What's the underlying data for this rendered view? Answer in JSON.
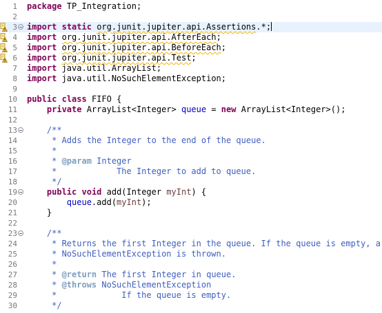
{
  "editor": {
    "lines": [
      {
        "n": "1",
        "tokens": [
          [
            "kw",
            "package"
          ],
          [
            "",
            " TP_Integration;"
          ]
        ]
      },
      {
        "n": "2",
        "tokens": []
      },
      {
        "n": "3",
        "fold": true,
        "marker": "warning",
        "current": true,
        "caret": true,
        "tokens": [
          [
            "kw",
            "import"
          ],
          [
            "",
            " "
          ],
          [
            "kw",
            "static"
          ],
          [
            "",
            " "
          ],
          [
            "warn",
            "org.junit.jupiter.api.Assertions"
          ],
          [
            "",
            ".*;"
          ]
        ]
      },
      {
        "n": "4",
        "marker": "warning",
        "tokens": [
          [
            "kw",
            "import"
          ],
          [
            "",
            " "
          ],
          [
            "warn",
            "org.junit.jupiter.api.AfterEach"
          ],
          [
            "",
            ";"
          ]
        ]
      },
      {
        "n": "5",
        "marker": "warning",
        "tokens": [
          [
            "kw",
            "import"
          ],
          [
            "",
            " "
          ],
          [
            "warn",
            "org.junit.jupiter.api.BeforeEach"
          ],
          [
            "",
            ";"
          ]
        ]
      },
      {
        "n": "6",
        "marker": "warning",
        "tokens": [
          [
            "kw",
            "import"
          ],
          [
            "",
            " "
          ],
          [
            "warn",
            "org.junit.jupiter.api.Test"
          ],
          [
            "",
            ";"
          ]
        ]
      },
      {
        "n": "7",
        "tokens": [
          [
            "kw",
            "import"
          ],
          [
            "",
            " java.util.ArrayList;"
          ]
        ]
      },
      {
        "n": "8",
        "tokens": [
          [
            "kw",
            "import"
          ],
          [
            "",
            " java.util.NoSuchElementException;"
          ]
        ]
      },
      {
        "n": "9",
        "tokens": []
      },
      {
        "n": "10",
        "tokens": [
          [
            "kw",
            "public"
          ],
          [
            "",
            " "
          ],
          [
            "kw",
            "class"
          ],
          [
            "",
            " FIFO {"
          ]
        ]
      },
      {
        "n": "11",
        "tokens": [
          [
            "",
            "    "
          ],
          [
            "kw",
            "private"
          ],
          [
            "",
            " ArrayList<Integer> "
          ],
          [
            "field",
            "queue"
          ],
          [
            "",
            " = "
          ],
          [
            "kw",
            "new"
          ],
          [
            "",
            " ArrayList<Integer>();"
          ]
        ]
      },
      {
        "n": "12",
        "tokens": []
      },
      {
        "n": "13",
        "fold": true,
        "tokens": [
          [
            "doc",
            "    /**"
          ]
        ]
      },
      {
        "n": "14",
        "tokens": [
          [
            "doc",
            "     * Adds the Integer to the end of the queue."
          ]
        ]
      },
      {
        "n": "15",
        "tokens": [
          [
            "doc",
            "     *"
          ]
        ]
      },
      {
        "n": "16",
        "tokens": [
          [
            "doc",
            "     * "
          ],
          [
            "doctag",
            "@param"
          ],
          [
            "doc",
            " Integer"
          ]
        ]
      },
      {
        "n": "17",
        "tokens": [
          [
            "doc",
            "     *            The Integer to add to queue."
          ]
        ]
      },
      {
        "n": "18",
        "tokens": [
          [
            "doc",
            "     */"
          ]
        ]
      },
      {
        "n": "19",
        "fold": true,
        "tokens": [
          [
            "",
            "    "
          ],
          [
            "kw",
            "public"
          ],
          [
            "",
            " "
          ],
          [
            "kw",
            "void"
          ],
          [
            "",
            " add(Integer "
          ],
          [
            "param",
            "myInt"
          ],
          [
            "",
            ") {"
          ]
        ]
      },
      {
        "n": "20",
        "tokens": [
          [
            "",
            "        "
          ],
          [
            "field",
            "queue"
          ],
          [
            "",
            ".add("
          ],
          [
            "param",
            "myInt"
          ],
          [
            "",
            ");"
          ]
        ]
      },
      {
        "n": "21",
        "tokens": [
          [
            "",
            "    }"
          ]
        ]
      },
      {
        "n": "22",
        "tokens": []
      },
      {
        "n": "23",
        "fold": true,
        "tokens": [
          [
            "doc",
            "    /**"
          ]
        ]
      },
      {
        "n": "24",
        "tokens": [
          [
            "doc",
            "     * Returns the first Integer in the queue. If the queue is empty, a"
          ]
        ]
      },
      {
        "n": "25",
        "tokens": [
          [
            "doc",
            "     * NoSuchElementException is thrown."
          ]
        ]
      },
      {
        "n": "26",
        "tokens": [
          [
            "doc",
            "     *"
          ]
        ]
      },
      {
        "n": "27",
        "tokens": [
          [
            "doc",
            "     * "
          ],
          [
            "doctag",
            "@return"
          ],
          [
            "doc",
            " The first Integer in queue."
          ]
        ]
      },
      {
        "n": "28",
        "tokens": [
          [
            "doc",
            "     * "
          ],
          [
            "doctag",
            "@throws"
          ],
          [
            "doc",
            " NoSuchElementException"
          ]
        ]
      },
      {
        "n": "29",
        "tokens": [
          [
            "doc",
            "     *             If the queue is empty."
          ]
        ]
      },
      {
        "n": "30",
        "tokens": [
          [
            "doc",
            "     */"
          ]
        ]
      }
    ]
  }
}
